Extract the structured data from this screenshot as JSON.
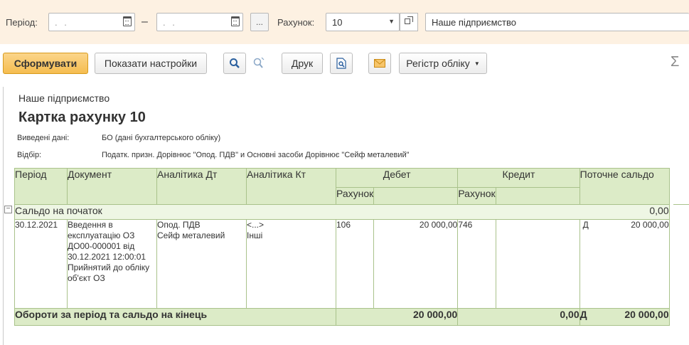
{
  "filter": {
    "period_label": "Період:",
    "date_from": ". .",
    "dash": "–",
    "date_to": ". .",
    "ellipsis": "...",
    "account_label": "Рахунок:",
    "account_value": "10",
    "organization": "Наше підприємство"
  },
  "toolbar": {
    "generate": "Сформувати",
    "show_settings": "Показати настройки",
    "print": "Друк",
    "register": "Регістр обліку",
    "sum_symbol": "Σ"
  },
  "report": {
    "company": "Наше підприємство",
    "title": "Картка рахунку 10",
    "data_label": "Виведені дані:",
    "data_value": "БО (дані бухгалтерського обліку)",
    "filter_label": "Відбір:",
    "filter_value": "Податк. призн. Дорівнює \"Опод. ПДВ\" и Основні засоби Дорівнює \"Сейф металевий\"",
    "columns": {
      "period": "Період",
      "document": "Документ",
      "analytics_dt": "Аналітика Дт",
      "analytics_kt": "Аналітика Кт",
      "debit": "Дебет",
      "credit": "Кредит",
      "balance": "Поточне сальдо",
      "debit_account": "Рахунок",
      "credit_account": "Рахунок"
    },
    "opening": {
      "toggle": "⊟",
      "label": "Сальдо на початок",
      "value": "0,00"
    },
    "rows": [
      {
        "period": "30.12.2021",
        "document_lines": [
          "Введення в",
          "експлуатацію ОЗ",
          "ДО00-000001 від",
          "30.12.2021 12:00:01",
          "Прийнятий до обліку",
          "об'єкт ОЗ"
        ],
        "analytics_dt_lines": [
          "Опод. ПДВ",
          "Сейф металевий"
        ],
        "analytics_kt_lines": [
          "<...>",
          "Інші"
        ],
        "debit_account": "106",
        "debit_amount": "20 000,00",
        "credit_account": "746",
        "credit_amount": "",
        "balance_side": "Д",
        "balance_amount": "20 000,00"
      }
    ],
    "totals": {
      "label": "Обороти за період та сальдо на кінець",
      "debit": "20 000,00",
      "credit": "0,00",
      "balance_side": "Д",
      "balance": "20 000,00"
    }
  }
}
